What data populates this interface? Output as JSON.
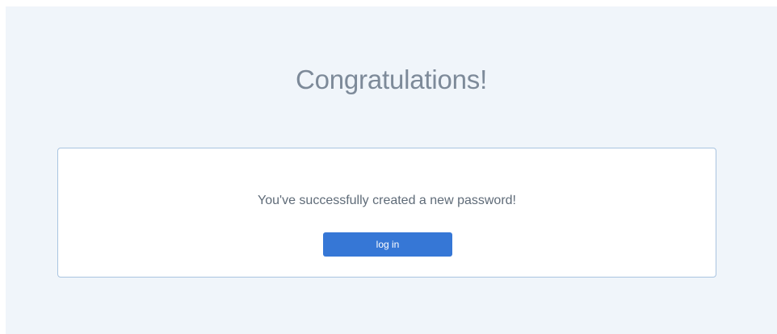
{
  "page": {
    "title": "Congratulations!",
    "message": "You've successfully created a new password!",
    "login_button_label": "log in"
  },
  "colors": {
    "background": "#f0f5fa",
    "card_border": "#a9c4e0",
    "button": "#3677d6",
    "title_text": "#7d8a99"
  }
}
